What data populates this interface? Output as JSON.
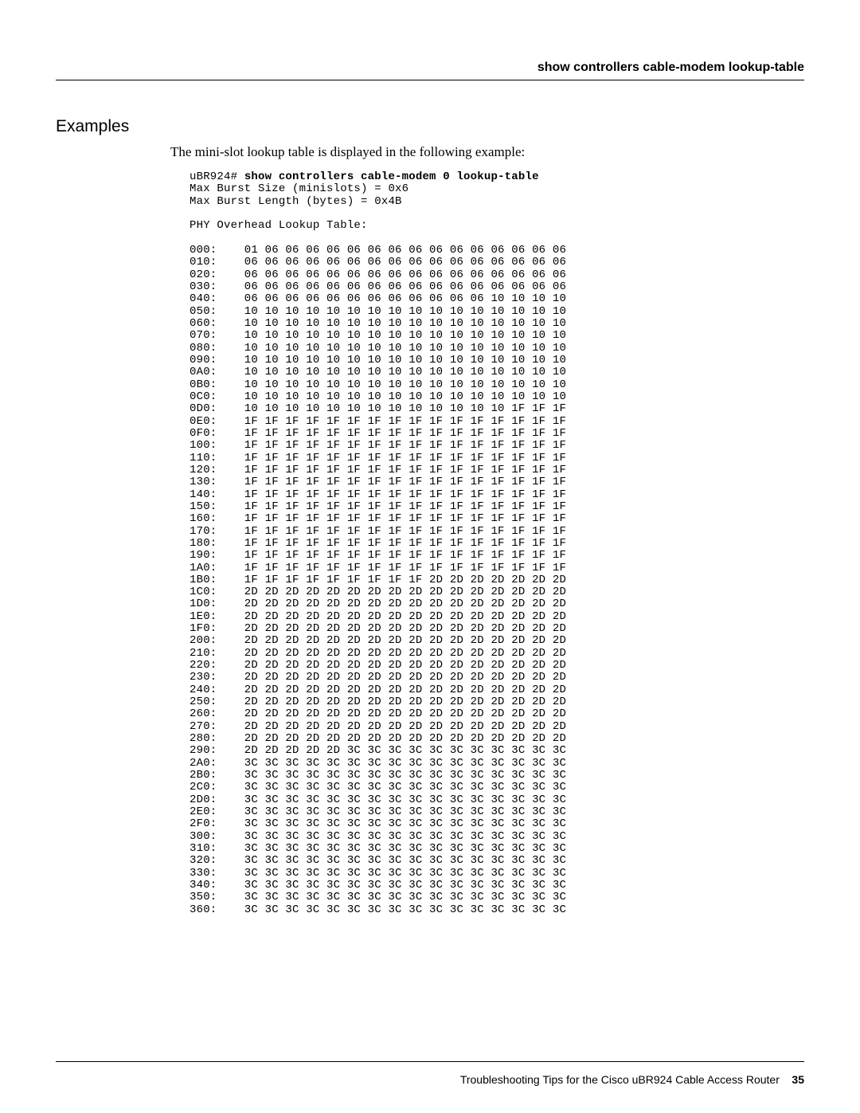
{
  "header": {
    "running_head": "show controllers cable-modem lookup-table"
  },
  "section": {
    "title": "Examples",
    "intro": "The mini-slot lookup table is displayed in the following example:"
  },
  "terminal": {
    "prompt": "uBR924# ",
    "command": "show controllers cable-modem 0 lookup-table",
    "lines": [
      "Max Burst Size (minislots) = 0x6",
      "Max Burst Length (bytes) = 0x4B",
      "",
      "PHY Overhead Lookup Table:",
      ""
    ],
    "table_rows": [
      {
        "addr": "000:",
        "bytes": [
          "01",
          "06",
          "06",
          "06",
          "06",
          "06",
          "06",
          "06",
          "06",
          "06",
          "06",
          "06",
          "06",
          "06",
          "06",
          "06"
        ]
      },
      {
        "addr": "010:",
        "bytes": [
          "06",
          "06",
          "06",
          "06",
          "06",
          "06",
          "06",
          "06",
          "06",
          "06",
          "06",
          "06",
          "06",
          "06",
          "06",
          "06"
        ]
      },
      {
        "addr": "020:",
        "bytes": [
          "06",
          "06",
          "06",
          "06",
          "06",
          "06",
          "06",
          "06",
          "06",
          "06",
          "06",
          "06",
          "06",
          "06",
          "06",
          "06"
        ]
      },
      {
        "addr": "030:",
        "bytes": [
          "06",
          "06",
          "06",
          "06",
          "06",
          "06",
          "06",
          "06",
          "06",
          "06",
          "06",
          "06",
          "06",
          "06",
          "06",
          "06"
        ]
      },
      {
        "addr": "040:",
        "bytes": [
          "06",
          "06",
          "06",
          "06",
          "06",
          "06",
          "06",
          "06",
          "06",
          "06",
          "06",
          "06",
          "10",
          "10",
          "10",
          "10"
        ]
      },
      {
        "addr": "050:",
        "bytes": [
          "10",
          "10",
          "10",
          "10",
          "10",
          "10",
          "10",
          "10",
          "10",
          "10",
          "10",
          "10",
          "10",
          "10",
          "10",
          "10"
        ]
      },
      {
        "addr": "060:",
        "bytes": [
          "10",
          "10",
          "10",
          "10",
          "10",
          "10",
          "10",
          "10",
          "10",
          "10",
          "10",
          "10",
          "10",
          "10",
          "10",
          "10"
        ]
      },
      {
        "addr": "070:",
        "bytes": [
          "10",
          "10",
          "10",
          "10",
          "10",
          "10",
          "10",
          "10",
          "10",
          "10",
          "10",
          "10",
          "10",
          "10",
          "10",
          "10"
        ]
      },
      {
        "addr": "080:",
        "bytes": [
          "10",
          "10",
          "10",
          "10",
          "10",
          "10",
          "10",
          "10",
          "10",
          "10",
          "10",
          "10",
          "10",
          "10",
          "10",
          "10"
        ]
      },
      {
        "addr": "090:",
        "bytes": [
          "10",
          "10",
          "10",
          "10",
          "10",
          "10",
          "10",
          "10",
          "10",
          "10",
          "10",
          "10",
          "10",
          "10",
          "10",
          "10"
        ]
      },
      {
        "addr": "0A0:",
        "bytes": [
          "10",
          "10",
          "10",
          "10",
          "10",
          "10",
          "10",
          "10",
          "10",
          "10",
          "10",
          "10",
          "10",
          "10",
          "10",
          "10"
        ]
      },
      {
        "addr": "0B0:",
        "bytes": [
          "10",
          "10",
          "10",
          "10",
          "10",
          "10",
          "10",
          "10",
          "10",
          "10",
          "10",
          "10",
          "10",
          "10",
          "10",
          "10"
        ]
      },
      {
        "addr": "0C0:",
        "bytes": [
          "10",
          "10",
          "10",
          "10",
          "10",
          "10",
          "10",
          "10",
          "10",
          "10",
          "10",
          "10",
          "10",
          "10",
          "10",
          "10"
        ]
      },
      {
        "addr": "0D0:",
        "bytes": [
          "10",
          "10",
          "10",
          "10",
          "10",
          "10",
          "10",
          "10",
          "10",
          "10",
          "10",
          "10",
          "10",
          "1F",
          "1F",
          "1F"
        ]
      },
      {
        "addr": "0E0:",
        "bytes": [
          "1F",
          "1F",
          "1F",
          "1F",
          "1F",
          "1F",
          "1F",
          "1F",
          "1F",
          "1F",
          "1F",
          "1F",
          "1F",
          "1F",
          "1F",
          "1F"
        ]
      },
      {
        "addr": "0F0:",
        "bytes": [
          "1F",
          "1F",
          "1F",
          "1F",
          "1F",
          "1F",
          "1F",
          "1F",
          "1F",
          "1F",
          "1F",
          "1F",
          "1F",
          "1F",
          "1F",
          "1F"
        ]
      },
      {
        "addr": "100:",
        "bytes": [
          "1F",
          "1F",
          "1F",
          "1F",
          "1F",
          "1F",
          "1F",
          "1F",
          "1F",
          "1F",
          "1F",
          "1F",
          "1F",
          "1F",
          "1F",
          "1F"
        ]
      },
      {
        "addr": "110:",
        "bytes": [
          "1F",
          "1F",
          "1F",
          "1F",
          "1F",
          "1F",
          "1F",
          "1F",
          "1F",
          "1F",
          "1F",
          "1F",
          "1F",
          "1F",
          "1F",
          "1F"
        ]
      },
      {
        "addr": "120:",
        "bytes": [
          "1F",
          "1F",
          "1F",
          "1F",
          "1F",
          "1F",
          "1F",
          "1F",
          "1F",
          "1F",
          "1F",
          "1F",
          "1F",
          "1F",
          "1F",
          "1F"
        ]
      },
      {
        "addr": "130:",
        "bytes": [
          "1F",
          "1F",
          "1F",
          "1F",
          "1F",
          "1F",
          "1F",
          "1F",
          "1F",
          "1F",
          "1F",
          "1F",
          "1F",
          "1F",
          "1F",
          "1F"
        ]
      },
      {
        "addr": "140:",
        "bytes": [
          "1F",
          "1F",
          "1F",
          "1F",
          "1F",
          "1F",
          "1F",
          "1F",
          "1F",
          "1F",
          "1F",
          "1F",
          "1F",
          "1F",
          "1F",
          "1F"
        ]
      },
      {
        "addr": "150:",
        "bytes": [
          "1F",
          "1F",
          "1F",
          "1F",
          "1F",
          "1F",
          "1F",
          "1F",
          "1F",
          "1F",
          "1F",
          "1F",
          "1F",
          "1F",
          "1F",
          "1F"
        ]
      },
      {
        "addr": "160:",
        "bytes": [
          "1F",
          "1F",
          "1F",
          "1F",
          "1F",
          "1F",
          "1F",
          "1F",
          "1F",
          "1F",
          "1F",
          "1F",
          "1F",
          "1F",
          "1F",
          "1F"
        ]
      },
      {
        "addr": "170:",
        "bytes": [
          "1F",
          "1F",
          "1F",
          "1F",
          "1F",
          "1F",
          "1F",
          "1F",
          "1F",
          "1F",
          "1F",
          "1F",
          "1F",
          "1F",
          "1F",
          "1F"
        ]
      },
      {
        "addr": "180:",
        "bytes": [
          "1F",
          "1F",
          "1F",
          "1F",
          "1F",
          "1F",
          "1F",
          "1F",
          "1F",
          "1F",
          "1F",
          "1F",
          "1F",
          "1F",
          "1F",
          "1F"
        ]
      },
      {
        "addr": "190:",
        "bytes": [
          "1F",
          "1F",
          "1F",
          "1F",
          "1F",
          "1F",
          "1F",
          "1F",
          "1F",
          "1F",
          "1F",
          "1F",
          "1F",
          "1F",
          "1F",
          "1F"
        ]
      },
      {
        "addr": "1A0:",
        "bytes": [
          "1F",
          "1F",
          "1F",
          "1F",
          "1F",
          "1F",
          "1F",
          "1F",
          "1F",
          "1F",
          "1F",
          "1F",
          "1F",
          "1F",
          "1F",
          "1F"
        ]
      },
      {
        "addr": "1B0:",
        "bytes": [
          "1F",
          "1F",
          "1F",
          "1F",
          "1F",
          "1F",
          "1F",
          "1F",
          "1F",
          "2D",
          "2D",
          "2D",
          "2D",
          "2D",
          "2D",
          "2D"
        ]
      },
      {
        "addr": "1C0:",
        "bytes": [
          "2D",
          "2D",
          "2D",
          "2D",
          "2D",
          "2D",
          "2D",
          "2D",
          "2D",
          "2D",
          "2D",
          "2D",
          "2D",
          "2D",
          "2D",
          "2D"
        ]
      },
      {
        "addr": "1D0:",
        "bytes": [
          "2D",
          "2D",
          "2D",
          "2D",
          "2D",
          "2D",
          "2D",
          "2D",
          "2D",
          "2D",
          "2D",
          "2D",
          "2D",
          "2D",
          "2D",
          "2D"
        ]
      },
      {
        "addr": "1E0:",
        "bytes": [
          "2D",
          "2D",
          "2D",
          "2D",
          "2D",
          "2D",
          "2D",
          "2D",
          "2D",
          "2D",
          "2D",
          "2D",
          "2D",
          "2D",
          "2D",
          "2D"
        ]
      },
      {
        "addr": "1F0:",
        "bytes": [
          "2D",
          "2D",
          "2D",
          "2D",
          "2D",
          "2D",
          "2D",
          "2D",
          "2D",
          "2D",
          "2D",
          "2D",
          "2D",
          "2D",
          "2D",
          "2D"
        ]
      },
      {
        "addr": "200:",
        "bytes": [
          "2D",
          "2D",
          "2D",
          "2D",
          "2D",
          "2D",
          "2D",
          "2D",
          "2D",
          "2D",
          "2D",
          "2D",
          "2D",
          "2D",
          "2D",
          "2D"
        ]
      },
      {
        "addr": "210:",
        "bytes": [
          "2D",
          "2D",
          "2D",
          "2D",
          "2D",
          "2D",
          "2D",
          "2D",
          "2D",
          "2D",
          "2D",
          "2D",
          "2D",
          "2D",
          "2D",
          "2D"
        ]
      },
      {
        "addr": "220:",
        "bytes": [
          "2D",
          "2D",
          "2D",
          "2D",
          "2D",
          "2D",
          "2D",
          "2D",
          "2D",
          "2D",
          "2D",
          "2D",
          "2D",
          "2D",
          "2D",
          "2D"
        ]
      },
      {
        "addr": "230:",
        "bytes": [
          "2D",
          "2D",
          "2D",
          "2D",
          "2D",
          "2D",
          "2D",
          "2D",
          "2D",
          "2D",
          "2D",
          "2D",
          "2D",
          "2D",
          "2D",
          "2D"
        ]
      },
      {
        "addr": "240:",
        "bytes": [
          "2D",
          "2D",
          "2D",
          "2D",
          "2D",
          "2D",
          "2D",
          "2D",
          "2D",
          "2D",
          "2D",
          "2D",
          "2D",
          "2D",
          "2D",
          "2D"
        ]
      },
      {
        "addr": "250:",
        "bytes": [
          "2D",
          "2D",
          "2D",
          "2D",
          "2D",
          "2D",
          "2D",
          "2D",
          "2D",
          "2D",
          "2D",
          "2D",
          "2D",
          "2D",
          "2D",
          "2D"
        ]
      },
      {
        "addr": "260:",
        "bytes": [
          "2D",
          "2D",
          "2D",
          "2D",
          "2D",
          "2D",
          "2D",
          "2D",
          "2D",
          "2D",
          "2D",
          "2D",
          "2D",
          "2D",
          "2D",
          "2D"
        ]
      },
      {
        "addr": "270:",
        "bytes": [
          "2D",
          "2D",
          "2D",
          "2D",
          "2D",
          "2D",
          "2D",
          "2D",
          "2D",
          "2D",
          "2D",
          "2D",
          "2D",
          "2D",
          "2D",
          "2D"
        ]
      },
      {
        "addr": "280:",
        "bytes": [
          "2D",
          "2D",
          "2D",
          "2D",
          "2D",
          "2D",
          "2D",
          "2D",
          "2D",
          "2D",
          "2D",
          "2D",
          "2D",
          "2D",
          "2D",
          "2D"
        ]
      },
      {
        "addr": "290:",
        "bytes": [
          "2D",
          "2D",
          "2D",
          "2D",
          "2D",
          "3C",
          "3C",
          "3C",
          "3C",
          "3C",
          "3C",
          "3C",
          "3C",
          "3C",
          "3C",
          "3C"
        ]
      },
      {
        "addr": "2A0:",
        "bytes": [
          "3C",
          "3C",
          "3C",
          "3C",
          "3C",
          "3C",
          "3C",
          "3C",
          "3C",
          "3C",
          "3C",
          "3C",
          "3C",
          "3C",
          "3C",
          "3C"
        ]
      },
      {
        "addr": "2B0:",
        "bytes": [
          "3C",
          "3C",
          "3C",
          "3C",
          "3C",
          "3C",
          "3C",
          "3C",
          "3C",
          "3C",
          "3C",
          "3C",
          "3C",
          "3C",
          "3C",
          "3C"
        ]
      },
      {
        "addr": "2C0:",
        "bytes": [
          "3C",
          "3C",
          "3C",
          "3C",
          "3C",
          "3C",
          "3C",
          "3C",
          "3C",
          "3C",
          "3C",
          "3C",
          "3C",
          "3C",
          "3C",
          "3C"
        ]
      },
      {
        "addr": "2D0:",
        "bytes": [
          "3C",
          "3C",
          "3C",
          "3C",
          "3C",
          "3C",
          "3C",
          "3C",
          "3C",
          "3C",
          "3C",
          "3C",
          "3C",
          "3C",
          "3C",
          "3C"
        ]
      },
      {
        "addr": "2E0:",
        "bytes": [
          "3C",
          "3C",
          "3C",
          "3C",
          "3C",
          "3C",
          "3C",
          "3C",
          "3C",
          "3C",
          "3C",
          "3C",
          "3C",
          "3C",
          "3C",
          "3C"
        ]
      },
      {
        "addr": "2F0:",
        "bytes": [
          "3C",
          "3C",
          "3C",
          "3C",
          "3C",
          "3C",
          "3C",
          "3C",
          "3C",
          "3C",
          "3C",
          "3C",
          "3C",
          "3C",
          "3C",
          "3C"
        ]
      },
      {
        "addr": "300:",
        "bytes": [
          "3C",
          "3C",
          "3C",
          "3C",
          "3C",
          "3C",
          "3C",
          "3C",
          "3C",
          "3C",
          "3C",
          "3C",
          "3C",
          "3C",
          "3C",
          "3C"
        ]
      },
      {
        "addr": "310:",
        "bytes": [
          "3C",
          "3C",
          "3C",
          "3C",
          "3C",
          "3C",
          "3C",
          "3C",
          "3C",
          "3C",
          "3C",
          "3C",
          "3C",
          "3C",
          "3C",
          "3C"
        ]
      },
      {
        "addr": "320:",
        "bytes": [
          "3C",
          "3C",
          "3C",
          "3C",
          "3C",
          "3C",
          "3C",
          "3C",
          "3C",
          "3C",
          "3C",
          "3C",
          "3C",
          "3C",
          "3C",
          "3C"
        ]
      },
      {
        "addr": "330:",
        "bytes": [
          "3C",
          "3C",
          "3C",
          "3C",
          "3C",
          "3C",
          "3C",
          "3C",
          "3C",
          "3C",
          "3C",
          "3C",
          "3C",
          "3C",
          "3C",
          "3C"
        ]
      },
      {
        "addr": "340:",
        "bytes": [
          "3C",
          "3C",
          "3C",
          "3C",
          "3C",
          "3C",
          "3C",
          "3C",
          "3C",
          "3C",
          "3C",
          "3C",
          "3C",
          "3C",
          "3C",
          "3C"
        ]
      },
      {
        "addr": "350:",
        "bytes": [
          "3C",
          "3C",
          "3C",
          "3C",
          "3C",
          "3C",
          "3C",
          "3C",
          "3C",
          "3C",
          "3C",
          "3C",
          "3C",
          "3C",
          "3C",
          "3C"
        ]
      },
      {
        "addr": "360:",
        "bytes": [
          "3C",
          "3C",
          "3C",
          "3C",
          "3C",
          "3C",
          "3C",
          "3C",
          "3C",
          "3C",
          "3C",
          "3C",
          "3C",
          "3C",
          "3C",
          "3C"
        ]
      }
    ]
  },
  "footer": {
    "text": "Troubleshooting Tips for the Cisco uBR924 Cable Access Router",
    "page": "35"
  }
}
